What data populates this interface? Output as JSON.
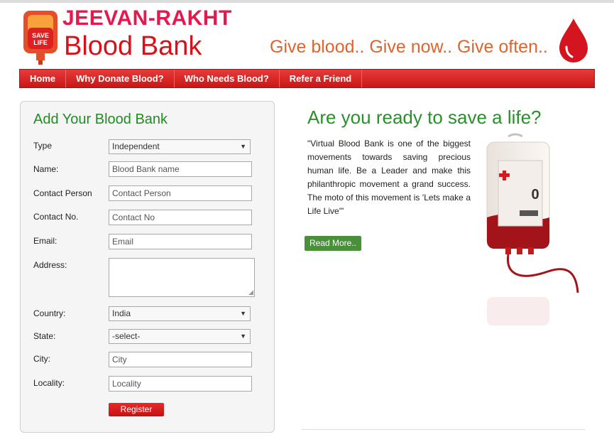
{
  "header": {
    "logo_badge": "SAVE LIFE",
    "brand_top": "JEEVAN-RAKHT",
    "brand_bottom": "Blood Bank",
    "tagline": "Give blood.. Give now.. Give often.."
  },
  "nav": {
    "items": [
      {
        "label": "Home"
      },
      {
        "label": "Why Donate Blood?"
      },
      {
        "label": "Who Needs Blood?"
      },
      {
        "label": "Refer a Friend"
      }
    ]
  },
  "form": {
    "title": "Add Your Blood Bank",
    "type": {
      "label": "Type",
      "value": "Independent"
    },
    "name": {
      "label": "Name:",
      "placeholder": "Blood Bank name"
    },
    "contact_person": {
      "label": "Contact Person",
      "placeholder": "Contact Person"
    },
    "contact_no": {
      "label": "Contact No.",
      "placeholder": "Contact No"
    },
    "email": {
      "label": "Email:",
      "placeholder": "Email"
    },
    "address": {
      "label": "Address:"
    },
    "country": {
      "label": "Country:",
      "value": "India"
    },
    "state": {
      "label": "State:",
      "value": "-select-"
    },
    "city": {
      "label": "City:",
      "placeholder": "City"
    },
    "locality": {
      "label": "Locality:",
      "placeholder": "Locality"
    },
    "register_label": "Register"
  },
  "promo": {
    "headline": "Are you ready to save a life?",
    "description": "\"Virtual Blood Bank is one of the biggest movements towards saving precious human life. Be a Leader and make this philanthropic movement a grand success. The moto of this movement is 'Lets make a Life Live'\"",
    "read_more_label": "Read More..",
    "bag_label": "0"
  },
  "colors": {
    "brand_red": "#d8101a",
    "title_green": "#2b8f2b",
    "tagline_orange": "#e0642c",
    "nav_red": "#c81717"
  },
  "icons": [
    "blood-bag-logo-icon",
    "blood-drop-icon",
    "blood-bag-illustration-icon"
  ]
}
